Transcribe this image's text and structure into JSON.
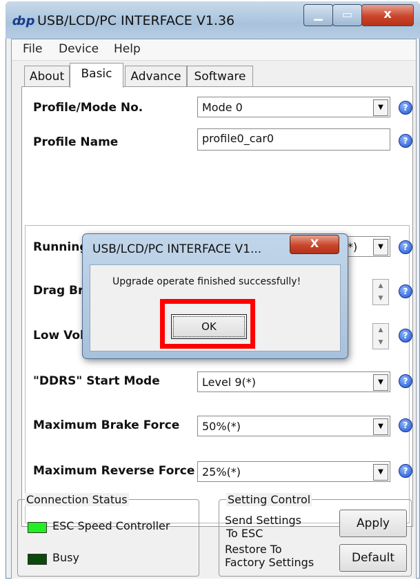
{
  "window": {
    "app_icon": "ȸp",
    "title": "USB/LCD/PC INTERFACE V1.36",
    "minimize": "▁",
    "maximize": "▭",
    "close": "x"
  },
  "menu": [
    "File",
    "Device",
    "Help"
  ],
  "tabs": [
    "About",
    "Basic",
    "Advance",
    "Software"
  ],
  "active_tab": "Basic",
  "basic": {
    "profile_label": "Profile/Mode No.",
    "profile_value": "Mode 0",
    "profile_name_label": "Profile Name",
    "profile_name_value": "profile0_car0",
    "running_label": "Running",
    "running_value_tail": "*)",
    "drag_label": "Drag Bra",
    "low_label": "Low Vol",
    "ddrs_label": "\"DDRS\" Start Mode",
    "ddrs_value": "Level 9(*)",
    "brake_label": "Maximum Brake Force",
    "brake_value": "50%(*)",
    "reverse_label": "Maximum Reverse Force",
    "reverse_value": "25%(*)"
  },
  "help_icon": "?",
  "dropdown_arrow": "▼",
  "spin": {
    "up": "▲",
    "down": "▼"
  },
  "connection": {
    "title": "Connection Status",
    "esc": "ESC Speed Controller",
    "busy": "Busy",
    "led_esc_color": "#22ee22",
    "led_busy_color": "#0a4a0a"
  },
  "setting": {
    "title": "Setting Control",
    "send_line1": "Send Settings",
    "send_line2": "To ESC",
    "restore_line1": "Restore To",
    "restore_line2": "Factory Settings",
    "apply": "Apply",
    "default": "Default"
  },
  "dialog": {
    "title": "USB/LCD/PC INTERFACE V1...",
    "close": "X",
    "message": "Upgrade operate finished successfully!",
    "ok": "OK"
  }
}
